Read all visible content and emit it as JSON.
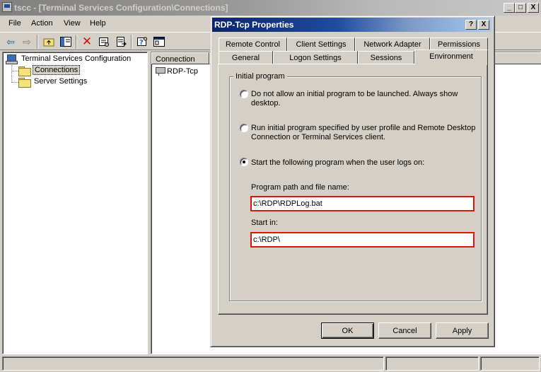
{
  "main_window": {
    "title": "tscc - [Terminal Services Configuration\\Connections]",
    "buttons": [
      "_",
      "□",
      "X"
    ]
  },
  "menu": [
    {
      "label": "File"
    },
    {
      "label": "Action"
    },
    {
      "label": "View"
    },
    {
      "label": "Help"
    }
  ],
  "toolbar": {
    "icons": [
      "back-arrow-icon",
      "forward-arrow-icon",
      "up-folder-icon",
      "show-hide-tree-icon",
      "delete-icon",
      "properties-icon",
      "export-list-icon",
      "help-icon",
      "console-icon"
    ]
  },
  "tree": {
    "root": "Terminal Services Configuration",
    "items": [
      "Connections",
      "Server Settings"
    ]
  },
  "list": {
    "column_header": "Connection",
    "rows": [
      "RDP-Tcp"
    ]
  },
  "dialog": {
    "title": "RDP-Tcp Properties",
    "title_buttons": [
      "?",
      "X"
    ],
    "tabs_row1": [
      "Remote Control",
      "Client Settings",
      "Network Adapter",
      "Permissions"
    ],
    "tabs_row2": [
      "General",
      "Logon Settings",
      "Sessions",
      "Environment"
    ],
    "active_tab": "Environment",
    "group_label": "Initial program",
    "options": [
      "Do not allow an initial program to be launched. Always show desktop.",
      "Run initial program specified by user profile and Remote Desktop Connection or Terminal Services client.",
      "Start the following program when the user logs on:"
    ],
    "selected_option": 2,
    "program_path_label": "Program path and file name:",
    "program_path_value": "c:\\RDP\\RDPLog.bat",
    "start_in_label": "Start in:",
    "start_in_value": "c:\\RDP\\",
    "buttons": {
      "ok": "OK",
      "cancel": "Cancel",
      "apply": "Apply"
    }
  }
}
